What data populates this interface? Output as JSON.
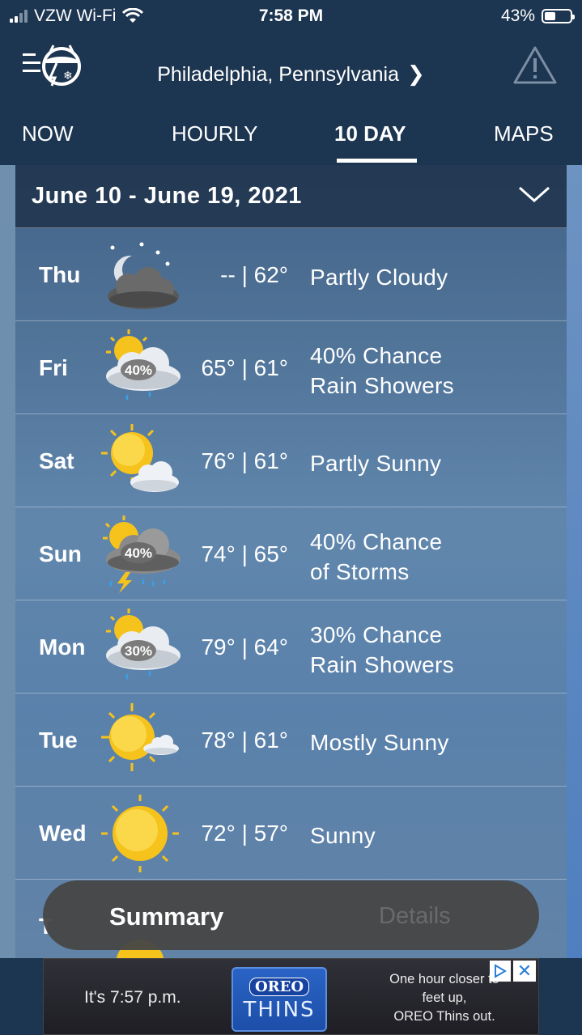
{
  "status_bar": {
    "carrier": "VZW Wi-Fi",
    "time": "7:58 PM",
    "battery": "43%",
    "battery_level": 0.43
  },
  "header": {
    "location": "Philadelphia,  Pennsylvania"
  },
  "tabs": [
    {
      "label": "NOW",
      "active": false
    },
    {
      "label": "HOURLY",
      "active": false
    },
    {
      "label": "10  DAY",
      "active": true
    },
    {
      "label": "MAPS",
      "active": false
    }
  ],
  "forecast": {
    "date_range": "June  10  -  June  19,  2021",
    "days": [
      {
        "day": "Thu",
        "temps": "-- | 62°",
        "condition": [
          "Partly  Cloudy"
        ],
        "icon": "partly-cloudy-night-icon"
      },
      {
        "day": "Fri",
        "temps": "65° | 61°",
        "condition": [
          "40%  Chance",
          "Rain  Showers"
        ],
        "icon": "rain-showers-icon",
        "pop": "40%"
      },
      {
        "day": "Sat",
        "temps": "76° | 61°",
        "condition": [
          "Partly  Sunny"
        ],
        "icon": "partly-sunny-icon"
      },
      {
        "day": "Sun",
        "temps": "74° | 65°",
        "condition": [
          "40%  Chance",
          "of  Storms"
        ],
        "icon": "thunderstorm-icon",
        "pop": "40%"
      },
      {
        "day": "Mon",
        "temps": "79° | 64°",
        "condition": [
          "30%  Chance",
          "Rain  Showers"
        ],
        "icon": "rain-showers-icon",
        "pop": "30%"
      },
      {
        "day": "Tue",
        "temps": "78° | 61°",
        "condition": [
          "Mostly  Sunny"
        ],
        "icon": "mostly-sunny-icon"
      },
      {
        "day": "Wed",
        "temps": "72° | 57°",
        "condition": [
          "Sunny"
        ],
        "icon": "sunny-icon"
      },
      {
        "day": "T",
        "temps": "",
        "condition": [
          ""
        ],
        "icon": "sunny-icon"
      }
    ]
  },
  "toggle": {
    "summary": "Summary",
    "details": "Details"
  },
  "ad": {
    "left_text": "It's 7:57 p.m.",
    "brand": "OREO",
    "product": "THINS",
    "right_line1": "One hour closer to",
    "right_line2": "feet up,",
    "right_line3": "OREO Thins out."
  },
  "colors": {
    "header_bg": "#1c3550",
    "sun": "#f6c21c",
    "cloud": "#eef1f5",
    "rain": "#3aa0e8"
  }
}
